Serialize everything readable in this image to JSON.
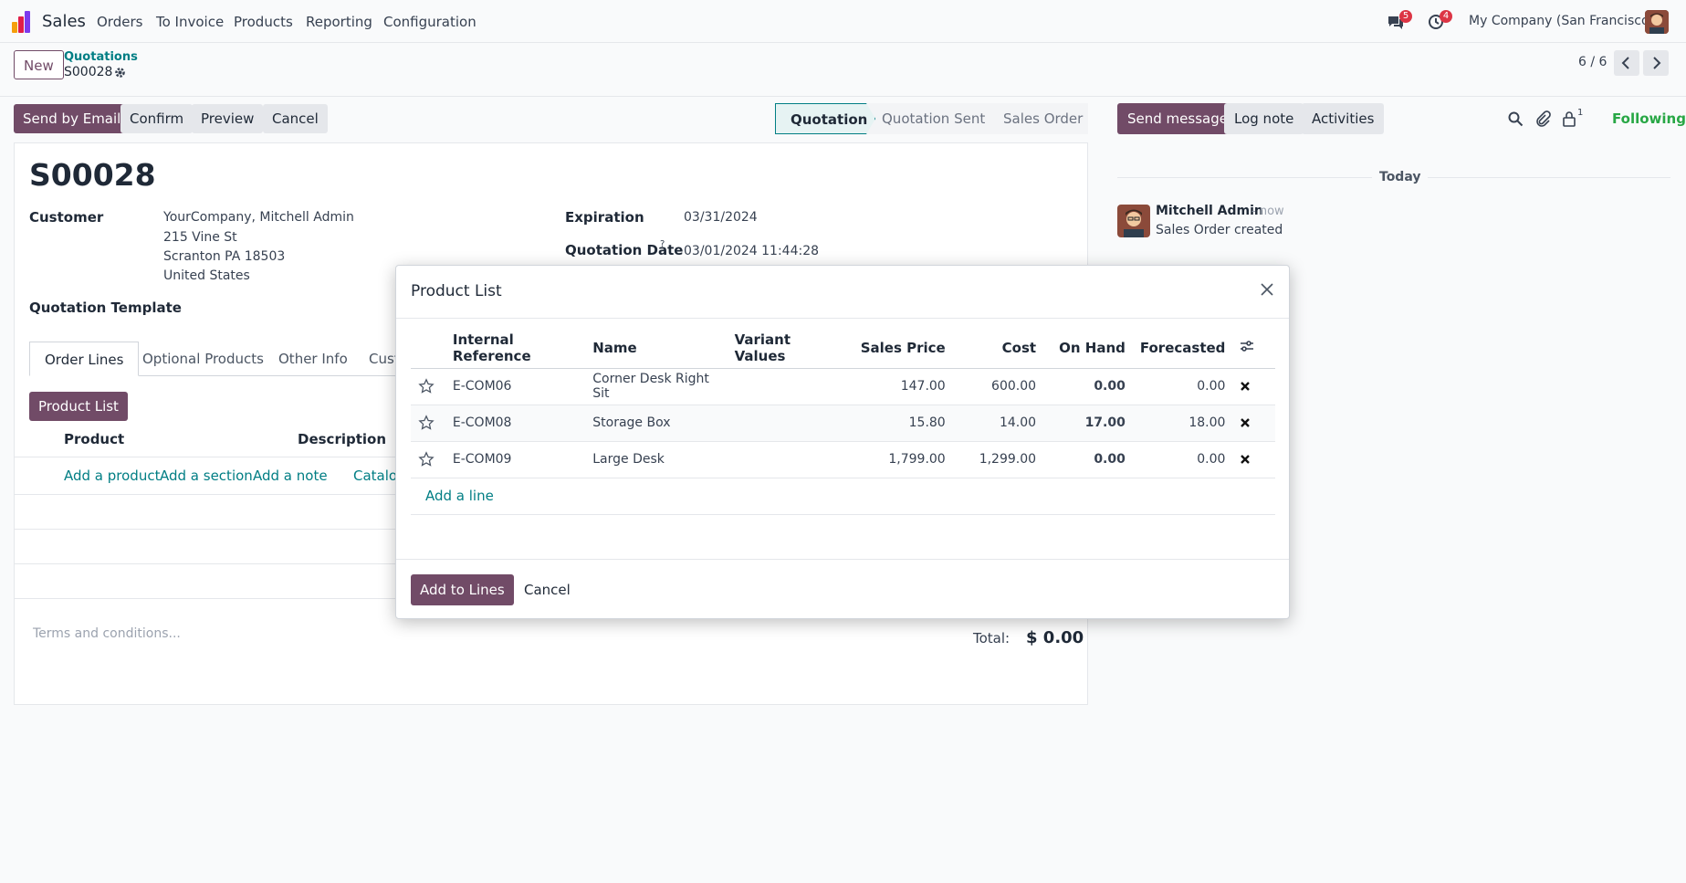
{
  "navbar": {
    "app_name": "Sales",
    "menu": [
      "Orders",
      "To Invoice",
      "Products",
      "Reporting",
      "Configuration"
    ],
    "messages_badge": "5",
    "activities_badge": "4",
    "company": "My Company (San Francisco)"
  },
  "control": {
    "new_label": "New",
    "breadcrumb": "Quotations",
    "record": "S00028",
    "pager": "6 / 6"
  },
  "actions": {
    "send_email": "Send by Email",
    "confirm": "Confirm",
    "preview": "Preview",
    "cancel": "Cancel"
  },
  "statusbar": [
    "Quotation",
    "Quotation Sent",
    "Sales Order"
  ],
  "form": {
    "title": "S00028",
    "customer_label": "Customer",
    "customer_lines": [
      "YourCompany, Mitchell Admin",
      "215 Vine St",
      "Scranton PA 18503",
      "United States"
    ],
    "expiration_label": "Expiration",
    "expiration": "03/31/2024",
    "quotation_date_label": "Quotation Date",
    "quotation_date_help": "?",
    "quotation_date": "03/01/2024 11:44:28",
    "template_label": "Quotation Template",
    "tabs": [
      "Order Lines",
      "Optional Products",
      "Other Info",
      "Cust"
    ],
    "product_list_button": "Product List",
    "col_product": "Product",
    "col_description": "Description",
    "add_product": "Add a product",
    "add_section": "Add a section",
    "add_note": "Add a note",
    "catalog": "Catalog",
    "terms_placeholder": "Terms and conditions...",
    "total_label": "Total:",
    "total_value": "$ 0.00"
  },
  "chatter": {
    "send_message": "Send message",
    "log_note": "Log note",
    "activities": "Activities",
    "followers_count": "1",
    "following": "Following",
    "today": "Today",
    "author": "Mitchell Admin",
    "time": "- now",
    "message": "Sales Order created"
  },
  "modal": {
    "title": "Product List",
    "columns": [
      "Internal Reference",
      "Name",
      "Variant Values",
      "Sales Price",
      "Cost",
      "On Hand",
      "Forecasted"
    ],
    "rows": [
      {
        "ref": "E-COM06",
        "name": "Corner Desk Right Sit",
        "variant": "",
        "price": "147.00",
        "cost": "600.00",
        "on_hand": "0.00",
        "forecasted": "0.00"
      },
      {
        "ref": "E-COM08",
        "name": "Storage Box",
        "variant": "",
        "price": "15.80",
        "cost": "14.00",
        "on_hand": "17.00",
        "forecasted": "18.00"
      },
      {
        "ref": "E-COM09",
        "name": "Large Desk",
        "variant": "",
        "price": "1,799.00",
        "cost": "1,299.00",
        "on_hand": "0.00",
        "forecasted": "0.00"
      }
    ],
    "add_line": "Add a line",
    "add_to_lines": "Add to Lines",
    "cancel": "Cancel"
  },
  "colors": {
    "primary": "#714b67",
    "teal": "#017e84",
    "amber": "#b8860b",
    "following_green": "#28a745"
  }
}
